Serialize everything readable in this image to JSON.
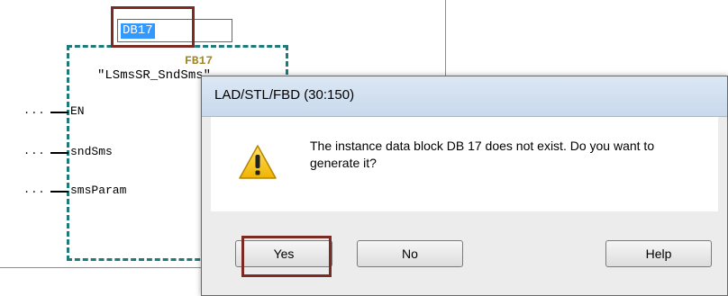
{
  "editor": {
    "db_field": {
      "value": "DB17"
    },
    "block": {
      "name": "FB17",
      "title": "\"LSmsSR_SndSms\""
    },
    "pins": [
      {
        "dots": "...",
        "label": "EN"
      },
      {
        "dots": "...",
        "label": "sndSms"
      },
      {
        "dots": "...",
        "label": "smsParam"
      }
    ]
  },
  "dialog": {
    "title": "LAD/STL/FBD  (30:150)",
    "icon": "warning-icon",
    "message": "The instance data block DB 17 does not exist. Do you want to generate it?",
    "buttons": {
      "yes": "Yes",
      "no": "No",
      "help": "Help"
    }
  },
  "colors": {
    "highlight": "#7b2a24",
    "block_border": "#1f7a7a",
    "selection": "#3399ff",
    "fb_name": "#a08a2a"
  }
}
